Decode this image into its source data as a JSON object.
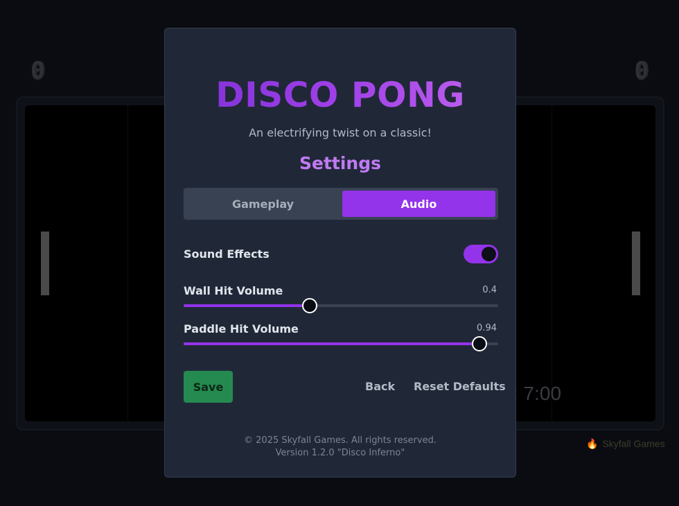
{
  "background": {
    "score_left": "0",
    "score_right": "0",
    "clock_text": "k: 7:00",
    "brand": "Skyfall Games",
    "brand_icon": "flame-icon"
  },
  "modal": {
    "title": "DISCO PONG",
    "tagline": "An electrifying twist on a classic!",
    "settings_heading": "Settings",
    "tabs": [
      {
        "label": "Gameplay",
        "active": false
      },
      {
        "label": "Audio",
        "active": true
      }
    ],
    "sound_effects": {
      "label": "Sound Effects",
      "enabled": true
    },
    "wall_hit_volume": {
      "label": "Wall Hit Volume",
      "value": "0.4",
      "level": 0.4
    },
    "paddle_hit_volume": {
      "label": "Paddle Hit Volume",
      "value": "0.94",
      "level": 0.94
    },
    "buttons": {
      "save": "Save",
      "back": "Back",
      "reset": "Reset Defaults"
    },
    "footer": {
      "copyright": "© 2025 Skyfall Games. All rights reserved.",
      "version": "Version 1.2.0 \"Disco Inferno\""
    }
  },
  "colors": {
    "accent": "#9333ea",
    "save": "#248a4f",
    "modal_bg": "#202838"
  }
}
